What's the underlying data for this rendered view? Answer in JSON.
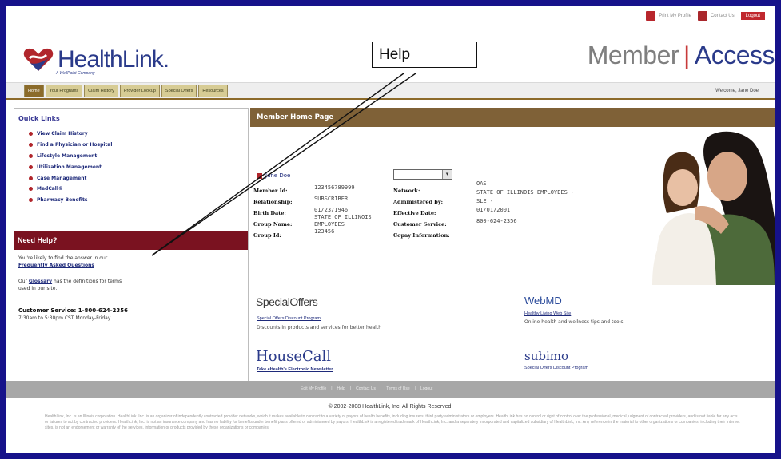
{
  "utility": {
    "print_profile": "Print My Profile",
    "contact_us": "Contact Us",
    "logout": "Logout"
  },
  "header": {
    "logo_text": "HealthLink.",
    "logo_sub": "A WellPoint Company",
    "member": "Member",
    "access": "Access"
  },
  "nav": {
    "tabs": [
      "Home",
      "Your Programs",
      "Claim History",
      "Provider Lookup",
      "Special Offers",
      "Resources"
    ],
    "welcome": "Welcome,  Jane Doe"
  },
  "sidebar": {
    "quick_links_title": "Quick Links",
    "quick_links": [
      "View Claim History",
      "Find a Physician or Hospital",
      "Lifestyle Management",
      "Utilization Management",
      "Case Management",
      "MedCall®",
      "Pharmacy Benefits"
    ],
    "need_help_title": "Need Help?",
    "help_line1": "You're likely to find the answer in our",
    "faq_link": "Frequently Asked Questions",
    "glossary_pre": "Our",
    "glossary_link": "Glossary",
    "glossary_post": "has the definitions for terms",
    "glossary_line2": "used in our site.",
    "customer_service": "Customer Service: 1-800-624-2356",
    "hours": "7:30am to 5:30pm CST Monday-Friday"
  },
  "main": {
    "title": "Member Home Page",
    "member_name": "Jane Doe",
    "labels_left": [
      "Member Id:",
      "Relationship:",
      "Birth Date:",
      "Group Name:",
      "Group Id:"
    ],
    "member_id": "123456789999",
    "relationship": "SUBSCRIBER",
    "birth_date": "01/23/1946",
    "group_name_1": "STATE OF ILLINOIS",
    "group_name_2": "EMPLOYEES",
    "group_id": "123456",
    "labels_right": [
      "Network:",
      "Administered by:",
      "Effective Date:",
      "Customer Service:",
      "Copay Information:"
    ],
    "network": "OAS",
    "administered_1": "STATE OF ILLINOIS EMPLOYEES -",
    "administered_2": "SLE -",
    "effective_date": "01/01/2001",
    "customer_service": "800-624-2356"
  },
  "promos": {
    "special_offers_title": "SpecialOffers",
    "special_offers_link": "Special Offers Discount Program",
    "special_offers_desc": "Discounts in products and services for better health",
    "webmd_title": "WebMD",
    "webmd_link": "Healthy Living Web Site",
    "webmd_desc": "Online health and wellness tips and tools",
    "housecall_title": "HouseCall",
    "housecall_link": "Take eHealth's Electronic Newsletter",
    "subimo_title": "subimo",
    "subimo_link": "Special Offers Discount Program"
  },
  "footer": {
    "links": [
      "Edit My Profile",
      "Help",
      "Contact Us",
      "Terms of Use",
      "Logout"
    ],
    "copyright": "© 2002-2008 HealthLink, Inc. All Rights Reserved.",
    "legal": "HealthLink, Inc. is an Illinois corporation. HealthLink, Inc. is an organizer of independently contracted provider networks, which it makes available to contract to a variety of payors of health benefits, including insurers, third party administrators or employers. HealthLink has no control or right of control over the professional, medical judgment of contracted providers, and is not liable for any acts or failures to act by contracted providers. HealthLink, Inc. is not an insurance company and has no liability for benefits under benefit plans offered or administered by payors. HealthLink is a registered trademark of HealthLink, Inc. and a separately incorporated and capitalized subsidiary of HealthLink, Inc. Any reference in the material to other organizations or companies, including their Internet sites, is not an endorsement or warranty of the services, information or products provided by these organizations or companies."
  },
  "annotation": {
    "callout": "Help"
  },
  "colors": {
    "frame": "#16128a",
    "brand_blue": "#2a3a8a",
    "brand_red": "#b1262c",
    "nav_brown": "#8b6b2a",
    "help_maroon": "#7a1220",
    "main_bar": "#7f6137"
  }
}
